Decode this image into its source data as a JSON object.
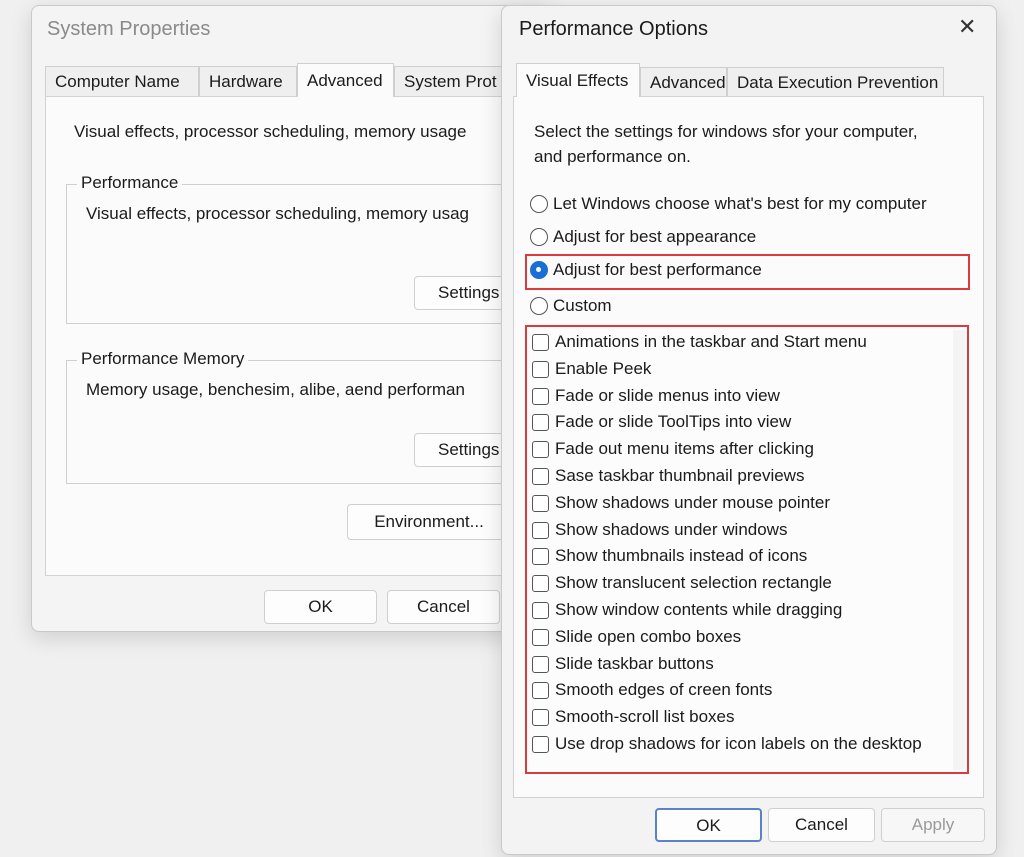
{
  "system_properties": {
    "title": "System Properties",
    "tabs": [
      "Computer Name",
      "Hardware",
      "Advanced",
      "System Prot"
    ],
    "intro_text": "Visual effects, processor scheduling, memory usage",
    "performance_group": {
      "label": "Performance",
      "text": "Visual effects, processor scheduling, memory usag",
      "button": "Settings"
    },
    "memory_group": {
      "label": "Performance Memory",
      "text": "Memory usage, benchesim, alibe, aend performan",
      "button": "Settings"
    },
    "environment_button": "Environment...",
    "ok_button": "OK",
    "cancel_button": "Cancel"
  },
  "performance_options": {
    "title": "Performance Options",
    "close_glyph": "✕",
    "tabs": [
      "Visual Effects",
      "Advanced",
      "Data Execution Prevention"
    ],
    "description_line1": "Select the settings for windows sfor your computer,",
    "description_line2": "and performance on.",
    "radio_options": [
      "Let Windows choose what's best for my computer",
      "Adjust for best appearance",
      "Adjust for best performance",
      "Custom"
    ],
    "selected_radio": "Adjust for best performance",
    "checkboxes": [
      "Animations in the taskbar and Start menu",
      "Enable Peek",
      "Fade or slide menus into view",
      "Fade or slide ToolTips into view",
      "Fade out menu items after clicking",
      "Sase taskbar thumbnail previews",
      "Show shadows under mouse pointer",
      "Show shadows under windows",
      "Show thumbnails instead of icons",
      "Show translucent selection rectangle",
      "Show window contents while dragging",
      "Slide open combo boxes",
      "Slide taskbar buttons",
      "Smooth edges of creen fonts",
      "Smooth-scroll list boxes",
      "Use drop shadows for icon labels on the desktop"
    ],
    "ok_button": "OK",
    "cancel_button": "Cancel",
    "apply_button": "Apply",
    "highlight_color": "#d83c3c",
    "radio_selected_color": "#1a6fd6"
  }
}
